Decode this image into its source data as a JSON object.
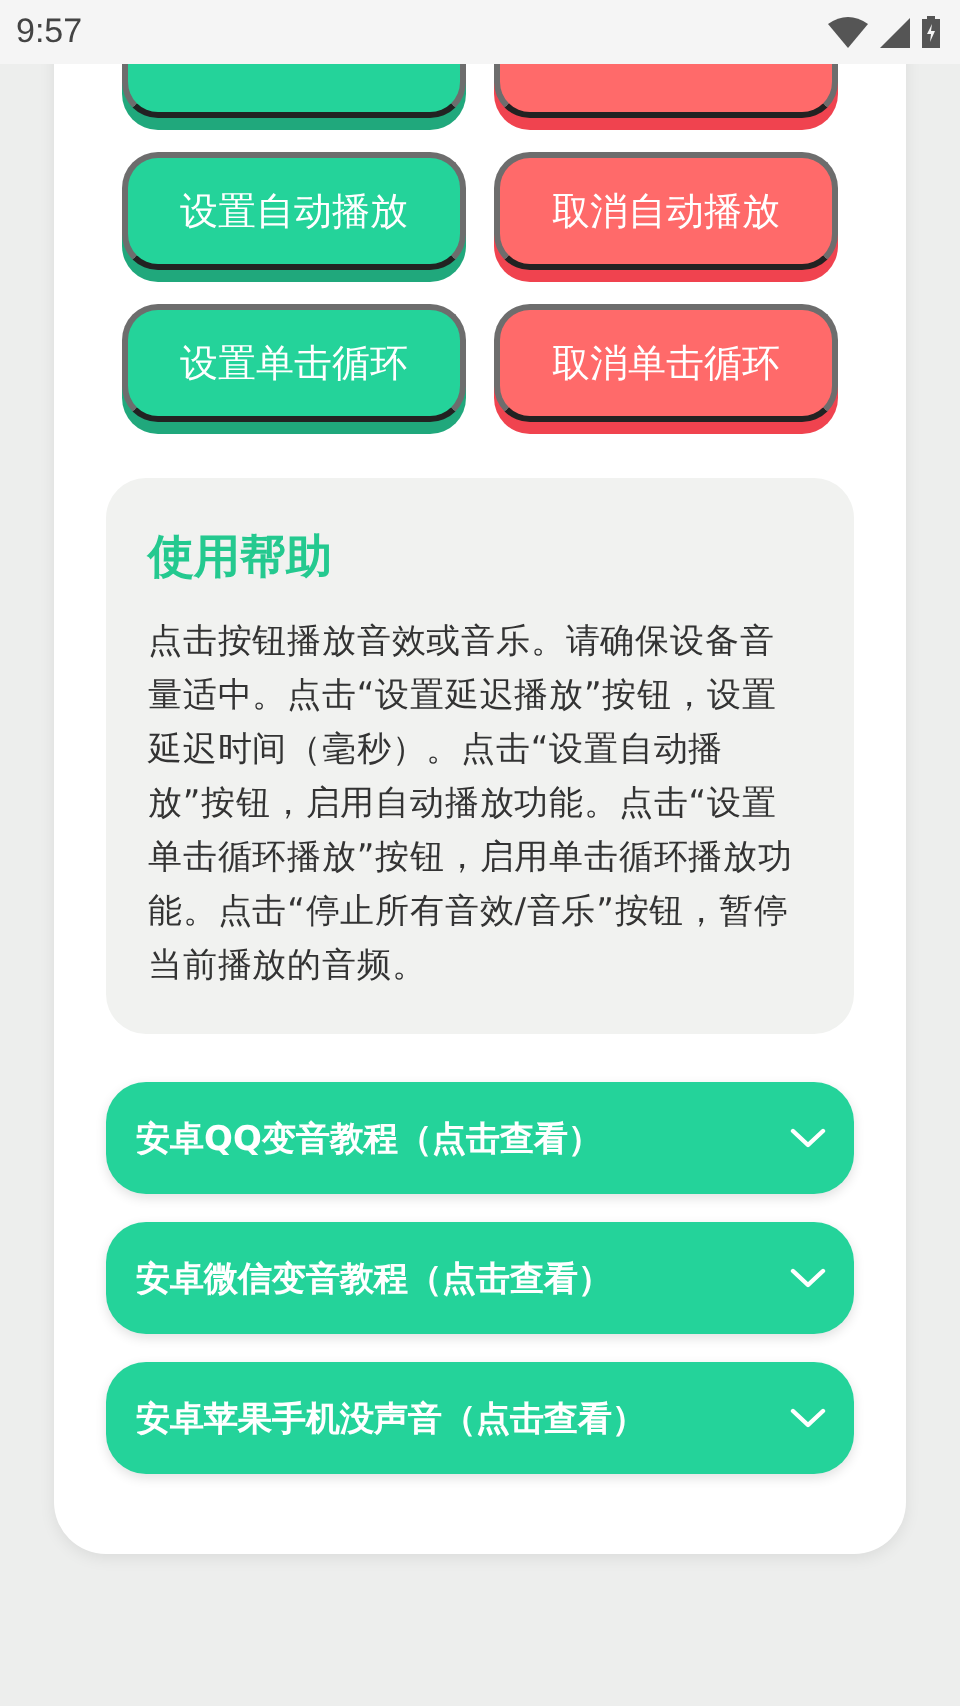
{
  "status_bar": {
    "time": "9:57"
  },
  "button_rows": [
    {
      "buttons": [
        {
          "kind": "set"
        },
        {
          "kind": "cancel"
        }
      ]
    },
    {
      "buttons": [
        {
          "label": "设置自动播放",
          "kind": "set"
        },
        {
          "label": "取消自动播放",
          "kind": "cancel"
        }
      ]
    },
    {
      "buttons": [
        {
          "label": "设置单击循环",
          "kind": "set"
        },
        {
          "label": "取消单击循环",
          "kind": "cancel"
        }
      ]
    }
  ],
  "help": {
    "title": "使用帮助",
    "text": "点击按钮播放音效或音乐。请确保设备音量适中。点击“设置延迟播放”按钮，设置延迟时间（毫秒）。点击“设置自动播放”按钮，启用自动播放功能。点击“设置单击循环播放”按钮，启用单击循环播放功能。点击“停止所有音效/音乐”按钮，暂停当前播放的音频。"
  },
  "accordions": [
    {
      "title": "安卓QQ变音教程（点击查看）",
      "expanded": false
    },
    {
      "title": "安卓微信变音教程（点击查看）",
      "expanded": false
    },
    {
      "title": "安卓苹果手机没声音（点击查看）",
      "expanded": false
    }
  ]
}
